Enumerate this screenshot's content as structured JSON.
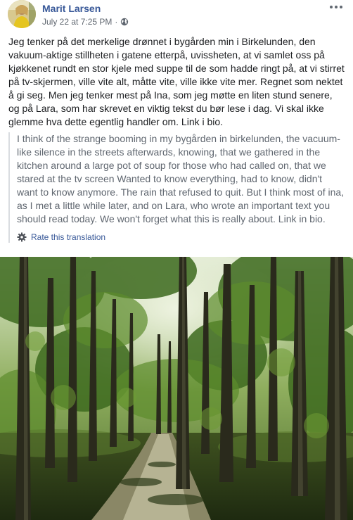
{
  "post": {
    "author": "Marit Larsen",
    "timestamp": "July 22 at 7:25 PM",
    "separator": "·",
    "privacy_icon": "globe-icon",
    "options_icon": "more-horizontal-icon",
    "text": "Jeg tenker på det merkelige drønnet i bygården min i Birkelunden, den vakuum-aktige stillheten i gatene etterpå, uvissheten, at vi samlet oss på kjøkkenet rundt en stor kjele med suppe til de som hadde ringt på, at vi stirret på tv-skjermen, ville vite alt, måtte vite, ville ikke vite mer. Regnet som nektet å gi seg. Men jeg tenker mest på Ina, som jeg møtte en liten stund senere, og på Lara, som har skrevet en viktig tekst du bør lese i dag. Vi skal ikke glemme hva dette egentlig handler om. Link i bio.",
    "translation": {
      "text": "I think of the strange booming in my bygården in birkelunden, the vacuum-like silence in the streets afterwards, knowing, that we gathered in the kitchen around a large pot of soup for those who had called on, that we stared at the tv screen Wanted to know everything, had to know, didn't want to know anymore. The rain that refused to quit. But I think most of ina, as I met a little while later, and on Lara, who wrote an important text you should read today. We won't forget what this is really about. Link in bio.",
      "rate_label": "Rate this translation",
      "rate_icon": "gear-icon"
    },
    "photo": {
      "description_icon": "forest-path-photo"
    }
  },
  "colors": {
    "author_link": "#385898",
    "meta_gray": "#606770",
    "body_text": "#1c1e21",
    "translation_border": "#dadde1"
  }
}
